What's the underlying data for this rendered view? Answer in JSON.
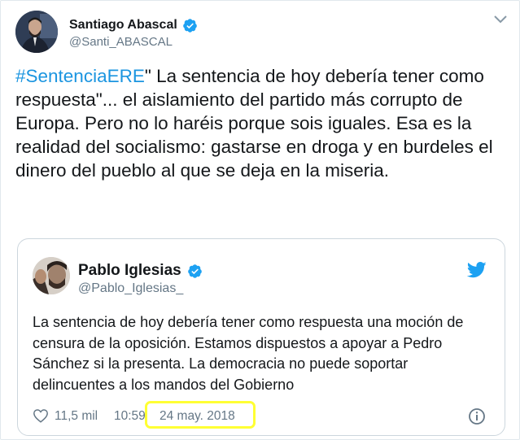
{
  "tweet": {
    "author": {
      "name": "Santiago Abascal",
      "handle": "@Santi_ABASCAL"
    },
    "hashtag": "#SentenciaERE",
    "text": "\" La sentencia de hoy debería tener como respuesta\"... el aislamiento del partido más corrupto de Europa. Pero no lo haréis porque sois iguales. Esa es la realidad del socialismo: gastarse en droga y en burdeles el dinero del pueblo al que se deja en la miseria.",
    "menu_icon": "chevron-down-icon"
  },
  "quoted": {
    "author": {
      "name": "Pablo Iglesias",
      "handle": "@Pablo_Iglesias_"
    },
    "text": "La sentencia de hoy debería tener como respuesta una moción de censura de la oposición. Estamos dispuestos a apoyar a Pedro Sánchez si la presenta. La democracia no puede soportar delincuentes a los mandos del Gobierno",
    "likes": "11,5 mil",
    "time": "10:59",
    "date": "24 may. 2018",
    "highlight_color": "#ffff33",
    "brand_icon": "twitter-bird-icon"
  },
  "colors": {
    "link": "#1b95e0",
    "verified": "#1da1f2",
    "muted": "#657786",
    "text": "#14171a"
  }
}
